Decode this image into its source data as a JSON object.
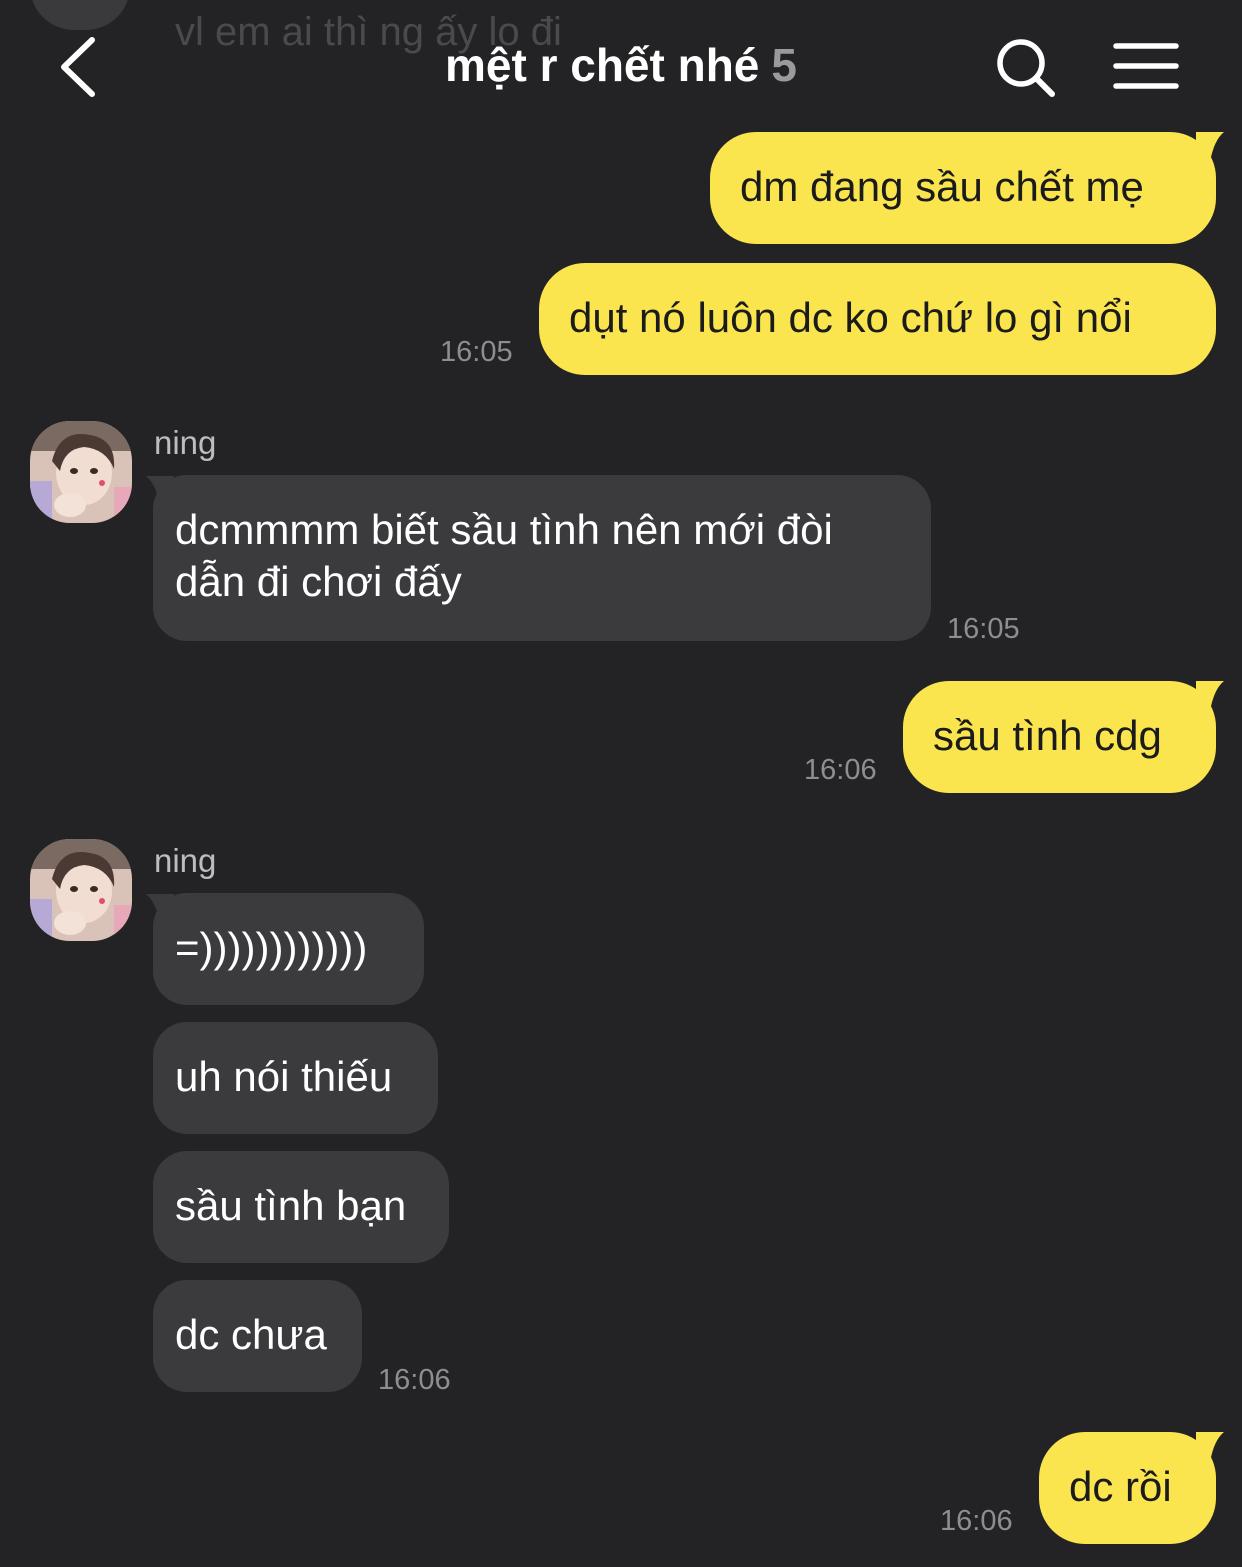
{
  "header": {
    "title": "mệt r chết nhé",
    "member_count": "5"
  },
  "ghost_message": "vl em ai thì ng ấy lo đi",
  "messages": {
    "m1": {
      "text": "dm đang sầu chết mẹ"
    },
    "m2": {
      "text": "dụt nó luôn dc ko chứ lo gì nổi",
      "time": "16:05"
    },
    "m3": {
      "sender": "ning",
      "line1": "dcmmmm biết sầu tình nên mới đòi",
      "line2": "dẫn đi chơi đấy",
      "time": "16:05"
    },
    "m4": {
      "text": "sầu tình cdg",
      "time": "16:06"
    },
    "m5": {
      "sender": "ning",
      "text": "=))))))))))))"
    },
    "m6": {
      "text": "uh nói thiếu"
    },
    "m7": {
      "text": "sầu tình bạn"
    },
    "m8": {
      "text": "dc chưa",
      "time": "16:06"
    },
    "m9": {
      "text": "dc rồi",
      "time": "16:06"
    }
  },
  "colors": {
    "background": "#232325",
    "outgoing_bubble": "#fae54e",
    "incoming_bubble": "#3b3b3e"
  },
  "icons": {
    "back": "chevron-left-icon",
    "search": "search-icon",
    "menu": "hamburger-menu-icon"
  }
}
